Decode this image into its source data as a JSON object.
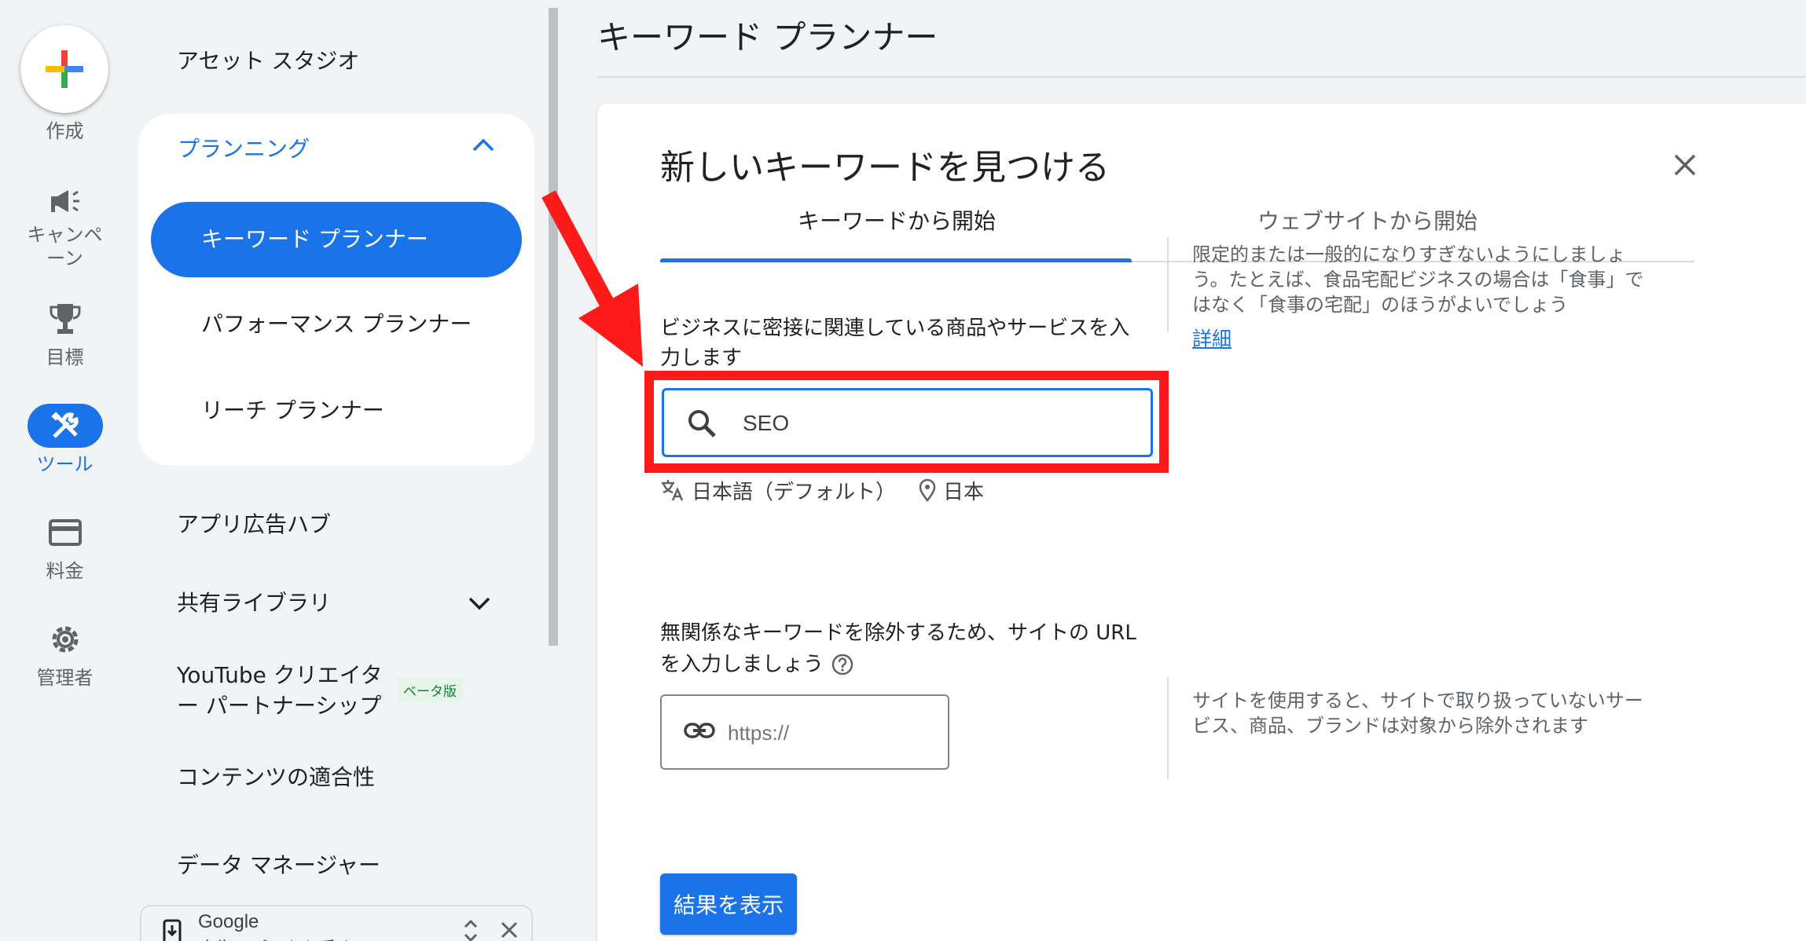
{
  "rail": {
    "create_label": "作成",
    "items": [
      {
        "label": "キャンペーン",
        "icon": "megaphone-icon"
      },
      {
        "label": "目標",
        "icon": "trophy-icon"
      },
      {
        "label": "ツール",
        "icon": "tools-icon",
        "active": true
      },
      {
        "label": "料金",
        "icon": "credit-card-icon"
      },
      {
        "label": "管理者",
        "icon": "gear-icon"
      }
    ]
  },
  "subnav": {
    "asset_studio": "アセット スタジオ",
    "planning": {
      "label": "プランニング",
      "items": [
        "キーワード プランナー",
        "パフォーマンス プランナー",
        "リーチ プランナー"
      ]
    },
    "app_ad_hub": "アプリ広告ハブ",
    "shared_library": "共有ライブラリ",
    "youtube_line1": "YouTube クリエイタ",
    "youtube_line2": "ー パートナーシップ",
    "beta_badge": "ベータ版",
    "content_suitability": "コンテンツの適合性",
    "data_manager": "データ マネージャー",
    "download_bar": {
      "line1": "Google",
      "line2": "広告アプリを入手する"
    }
  },
  "page_title": "キーワード プランナー",
  "dialog": {
    "title": "新しいキーワードを見つける",
    "tabs": [
      "キーワードから開始",
      "ウェブサイトから開始"
    ],
    "keyword_label_line1": "ビジネスに密接に関連している商品やサービスを入",
    "keyword_label_line2": "力します",
    "keyword_value": "SEO",
    "language": "日本語（デフォルト）",
    "location": "日本",
    "hint1_lines": [
      "限定的または一般的になりすぎないようにしましょ",
      "う。たとえば、食品宅配ビジネスの場合は「食事」で",
      "はなく「食事の宅配」のほうがよいでしょう"
    ],
    "hint1_link": "詳細",
    "url_label_line1": "無関係なキーワードを除外するため、サイトの URL",
    "url_label_line2": "を入力しましょう",
    "url_placeholder": "https://",
    "hint2_lines": [
      "サイトを使用すると、サイトで取り扱っていないサー",
      "ビス、商品、ブランドは対象から除外されます"
    ],
    "submit": "結果を表示"
  },
  "colors": {
    "accent": "#1a73e8",
    "highlight": "#ff1a1a"
  }
}
